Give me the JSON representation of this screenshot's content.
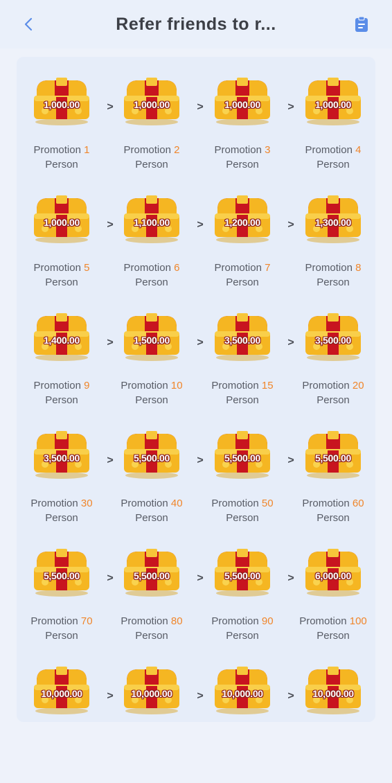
{
  "header": {
    "title": "Refer friends to r...",
    "back_icon": "chevron-left-icon",
    "action_icon": "clipboard-icon",
    "accent_color": "#5b8de8"
  },
  "arrow_glyph": ">",
  "rewards": [
    {
      "amount": "1,000.00",
      "label_prefix": "Promotion",
      "count": "1",
      "label_suffix": "Person"
    },
    {
      "amount": "1,000.00",
      "label_prefix": "Promotion",
      "count": "2",
      "label_suffix": "Person"
    },
    {
      "amount": "1,000.00",
      "label_prefix": "Promotion",
      "count": "3",
      "label_suffix": "Person"
    },
    {
      "amount": "1,000.00",
      "label_prefix": "Promotion",
      "count": "4",
      "label_suffix": "Person"
    },
    {
      "amount": "1,000.00",
      "label_prefix": "Promotion",
      "count": "5",
      "label_suffix": "Person"
    },
    {
      "amount": "1,100.00",
      "label_prefix": "Promotion",
      "count": "6",
      "label_suffix": "Person"
    },
    {
      "amount": "1,200.00",
      "label_prefix": "Promotion",
      "count": "7",
      "label_suffix": "Person"
    },
    {
      "amount": "1,300.00",
      "label_prefix": "Promotion",
      "count": "8",
      "label_suffix": "Person"
    },
    {
      "amount": "1,400.00",
      "label_prefix": "Promotion",
      "count": "9",
      "label_suffix": "Person"
    },
    {
      "amount": "1,500.00",
      "label_prefix": "Promotion",
      "count": "10",
      "label_suffix": "Person"
    },
    {
      "amount": "3,500.00",
      "label_prefix": "Promotion",
      "count": "15",
      "label_suffix": "Person"
    },
    {
      "amount": "3,500.00",
      "label_prefix": "Promotion",
      "count": "20",
      "label_suffix": "Person"
    },
    {
      "amount": "3,500.00",
      "label_prefix": "Promotion",
      "count": "30",
      "label_suffix": "Person"
    },
    {
      "amount": "5,500.00",
      "label_prefix": "Promotion",
      "count": "40",
      "label_suffix": "Person"
    },
    {
      "amount": "5,500.00",
      "label_prefix": "Promotion",
      "count": "50",
      "label_suffix": "Person"
    },
    {
      "amount": "5,500.00",
      "label_prefix": "Promotion",
      "count": "60",
      "label_suffix": "Person"
    },
    {
      "amount": "5,500.00",
      "label_prefix": "Promotion",
      "count": "70",
      "label_suffix": "Person"
    },
    {
      "amount": "5,500.00",
      "label_prefix": "Promotion",
      "count": "80",
      "label_suffix": "Person"
    },
    {
      "amount": "5,500.00",
      "label_prefix": "Promotion",
      "count": "90",
      "label_suffix": "Person"
    },
    {
      "amount": "6,000.00",
      "label_prefix": "Promotion",
      "count": "100",
      "label_suffix": "Person"
    },
    {
      "amount": "10,000.00",
      "label_prefix": "",
      "count": "",
      "label_suffix": ""
    },
    {
      "amount": "10,000.00",
      "label_prefix": "",
      "count": "",
      "label_suffix": ""
    },
    {
      "amount": "10,000.00",
      "label_prefix": "",
      "count": "",
      "label_suffix": ""
    },
    {
      "amount": "10,000.00",
      "label_prefix": "",
      "count": "",
      "label_suffix": ""
    }
  ],
  "colors": {
    "count_highlight": "#f0862b",
    "chest_gold": "#f5b622",
    "chest_red": "#c8141f"
  }
}
